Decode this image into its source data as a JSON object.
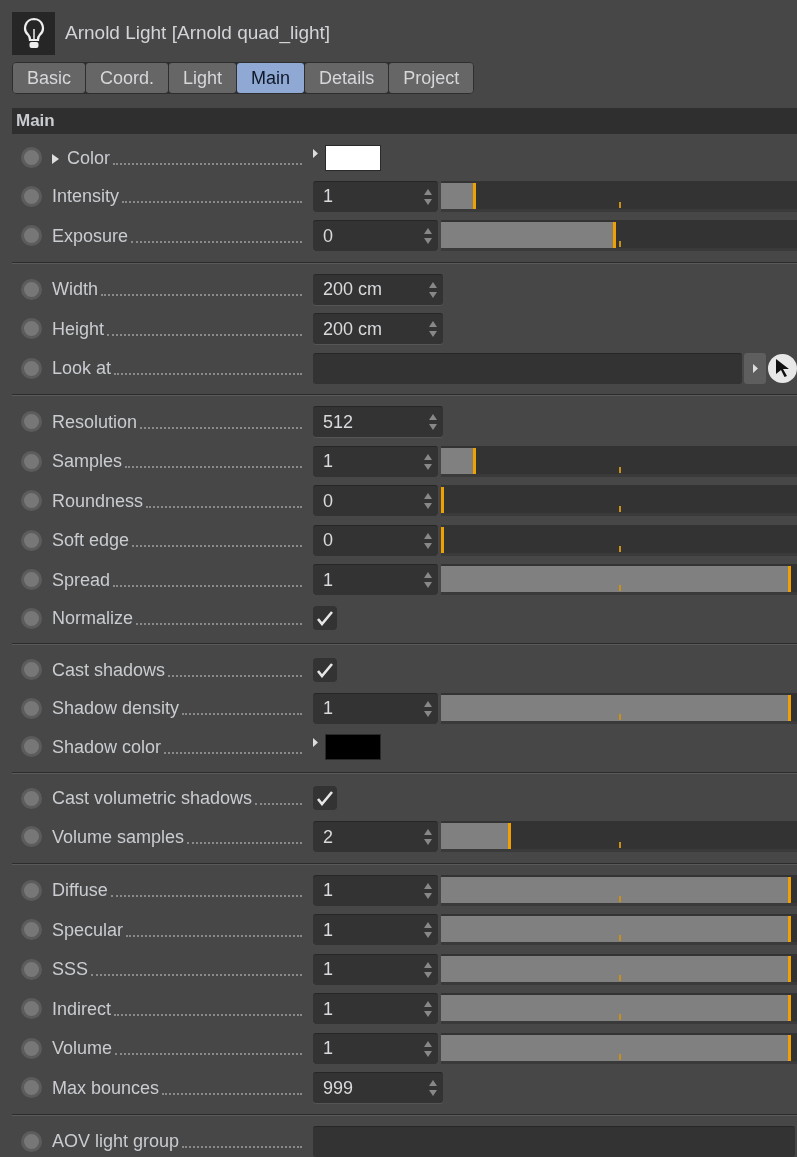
{
  "header": {
    "title": "Arnold Light [Arnold quad_light]"
  },
  "tabs": [
    {
      "label": "Basic",
      "selected": false
    },
    {
      "label": "Coord.",
      "selected": false
    },
    {
      "label": "Light",
      "selected": false
    },
    {
      "label": "Main",
      "selected": true
    },
    {
      "label": "Details",
      "selected": false
    },
    {
      "label": "Project",
      "selected": false
    }
  ],
  "section": {
    "title": "Main"
  },
  "groups": [
    [
      {
        "kind": "color",
        "label": "Color",
        "expanded": false,
        "color": "#ffffff"
      },
      {
        "kind": "slider",
        "label": "Intensity",
        "value": "1",
        "level": 0.1
      },
      {
        "kind": "slider",
        "label": "Exposure",
        "value": "0",
        "level": 0.5
      }
    ],
    [
      {
        "kind": "number",
        "label": "Width",
        "value": "200 cm"
      },
      {
        "kind": "number",
        "label": "Height",
        "value": "200 cm"
      },
      {
        "kind": "link",
        "label": "Look at"
      }
    ],
    [
      {
        "kind": "number",
        "label": "Resolution",
        "value": "512"
      },
      {
        "kind": "slider",
        "label": "Samples",
        "value": "1",
        "level": 0.1
      },
      {
        "kind": "slider",
        "label": "Roundness",
        "value": "0",
        "level": 0
      },
      {
        "kind": "slider",
        "label": "Soft edge",
        "value": "0",
        "level": 0
      },
      {
        "kind": "slider",
        "label": "Spread",
        "value": "1",
        "level": 1
      },
      {
        "kind": "checkbox",
        "label": "Normalize",
        "checked": true
      }
    ],
    [
      {
        "kind": "checkbox",
        "label": "Cast shadows",
        "checked": true
      },
      {
        "kind": "slider",
        "label": "Shadow density",
        "value": "1",
        "level": 1
      },
      {
        "kind": "color",
        "label": "Shadow color",
        "color": "#000000"
      }
    ],
    [
      {
        "kind": "checkbox",
        "label": "Cast volumetric shadows",
        "checked": true
      },
      {
        "kind": "slider",
        "label": "Volume samples",
        "value": "2",
        "level": 0.2
      }
    ],
    [
      {
        "kind": "slider",
        "label": "Diffuse",
        "value": "1",
        "level": 1
      },
      {
        "kind": "slider",
        "label": "Specular",
        "value": "1",
        "level": 1
      },
      {
        "kind": "slider",
        "label": "SSS",
        "value": "1",
        "level": 1
      },
      {
        "kind": "slider",
        "label": "Indirect",
        "value": "1",
        "level": 1
      },
      {
        "kind": "slider",
        "label": "Volume",
        "value": "1",
        "level": 1
      },
      {
        "kind": "number",
        "label": "Max bounces",
        "value": "999"
      }
    ],
    [
      {
        "kind": "text",
        "label": "AOV light group"
      }
    ]
  ]
}
